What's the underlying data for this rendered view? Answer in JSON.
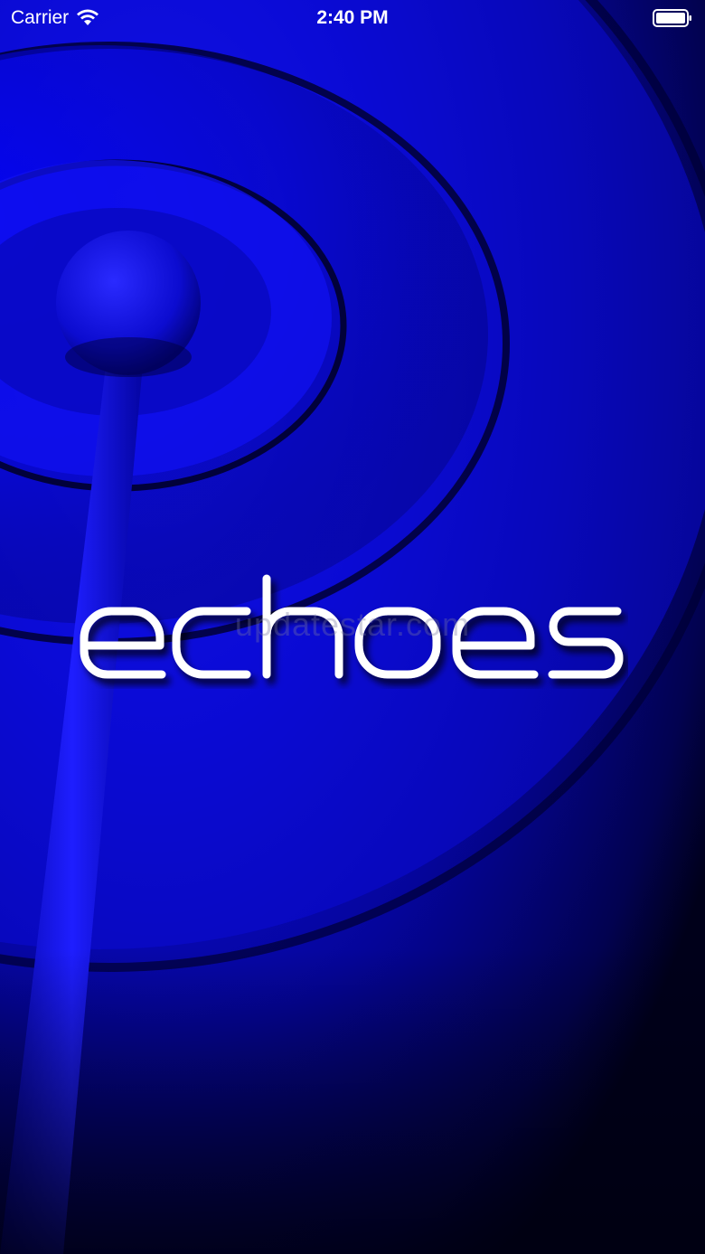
{
  "status_bar": {
    "carrier": "Carrier",
    "time": "2:40 PM",
    "wifi_icon": "wifi-icon",
    "battery_icon": "battery-icon"
  },
  "splash": {
    "logo_text": "echoes",
    "watermark": "updatestar.com",
    "background_art": "radio-tower-waves",
    "colors": {
      "primary": "#1414ff",
      "deep": "#020240",
      "text": "#ffffff"
    }
  }
}
